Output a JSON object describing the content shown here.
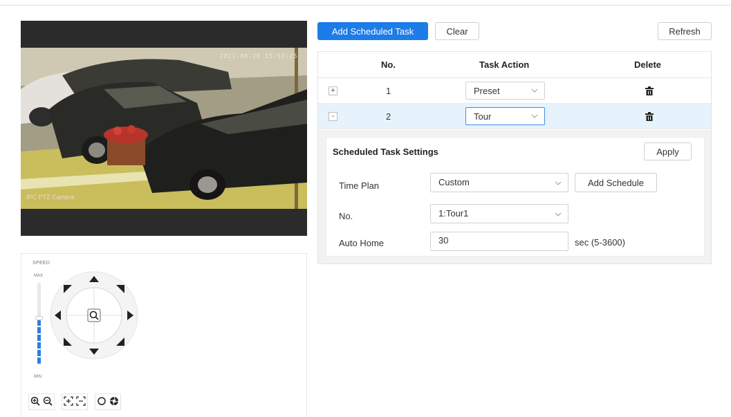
{
  "video": {
    "osd_timestamp": "2021-08-26 15:52:25",
    "osd_channel": "IPC PTZ Camera"
  },
  "ptz": {
    "speed_label": "SPEED",
    "max_label": "MAX",
    "min_label": "MIN",
    "speed_level": 0.55,
    "icons": [
      "zoom-in-icon",
      "zoom-out-icon",
      "focus-near-icon",
      "focus-far-icon",
      "iris-icon",
      "aperture-icon"
    ]
  },
  "toolbar": {
    "add_task_label": "Add Scheduled Task",
    "clear_label": "Clear",
    "refresh_label": "Refresh"
  },
  "table": {
    "headers": {
      "no": "No.",
      "task_action": "Task Action",
      "delete": "Delete"
    },
    "rows": [
      {
        "expander": "+",
        "no": "1",
        "action": "Preset"
      },
      {
        "expander": "-",
        "no": "2",
        "action": "Tour"
      }
    ]
  },
  "settings": {
    "title": "Scheduled Task Settings",
    "apply_label": "Apply",
    "time_plan_label": "Time Plan",
    "time_plan_value": "Custom",
    "add_schedule_label": "Add Schedule",
    "no_label": "No.",
    "no_value": "1:Tour1",
    "auto_home_label": "Auto Home",
    "auto_home_value": "30",
    "auto_home_suffix": "sec (5-3600)"
  },
  "colors": {
    "primary": "#1e7ce8",
    "selected_row": "#e6f2fc",
    "speed_fill": "#2a7ee8"
  }
}
